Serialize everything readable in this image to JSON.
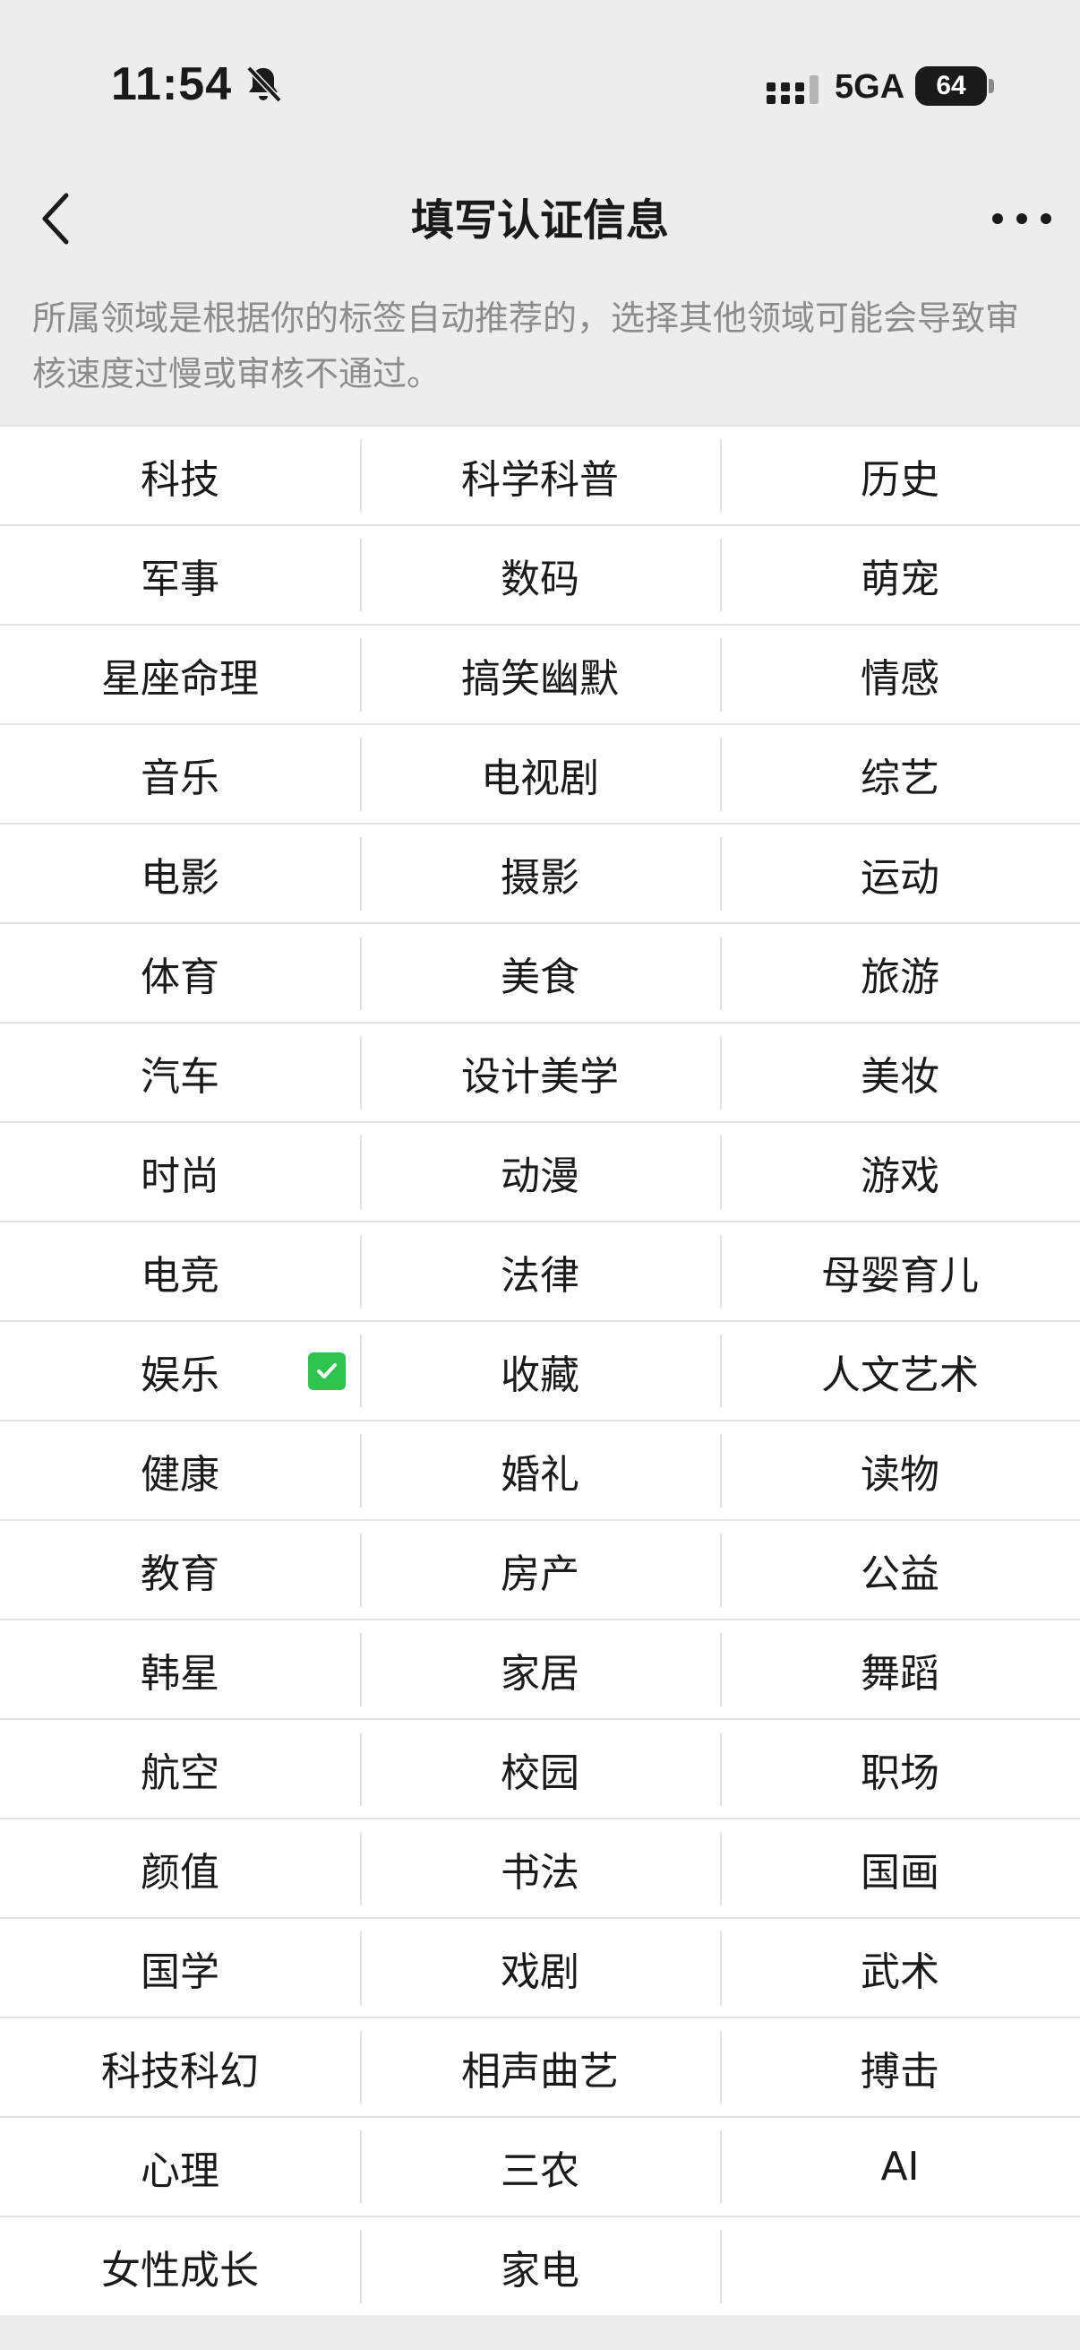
{
  "status_bar": {
    "time": "11:54",
    "network": "5GA",
    "battery": "64",
    "icons": [
      "bell-muted-icon",
      "signal-icon",
      "battery-icon"
    ]
  },
  "nav": {
    "title": "填写认证信息",
    "back_icon": "chevron-left-icon",
    "more_icon": "more-dots-icon"
  },
  "notice": "所属领域是根据你的标签自动推荐的，选择其他领域可能会导致审核速度过慢或审核不通过。",
  "accent_color": "#2dc34f",
  "categories": {
    "rows": [
      [
        "科技",
        "科学科普",
        "历史"
      ],
      [
        "军事",
        "数码",
        "萌宠"
      ],
      [
        "星座命理",
        "搞笑幽默",
        "情感"
      ],
      [
        "音乐",
        "电视剧",
        "综艺"
      ],
      [
        "电影",
        "摄影",
        "运动"
      ],
      [
        "体育",
        "美食",
        "旅游"
      ],
      [
        "汽车",
        "设计美学",
        "美妆"
      ],
      [
        "时尚",
        "动漫",
        "游戏"
      ],
      [
        "电竞",
        "法律",
        "母婴育儿"
      ],
      [
        "娱乐",
        "收藏",
        "人文艺术"
      ],
      [
        "健康",
        "婚礼",
        "读物"
      ],
      [
        "教育",
        "房产",
        "公益"
      ],
      [
        "韩星",
        "家居",
        "舞蹈"
      ],
      [
        "航空",
        "校园",
        "职场"
      ],
      [
        "颜值",
        "书法",
        "国画"
      ],
      [
        "国学",
        "戏剧",
        "武术"
      ],
      [
        "科技科幻",
        "相声曲艺",
        "搏击"
      ],
      [
        "心理",
        "三农",
        "AI"
      ],
      [
        "女性成长",
        "家电",
        ""
      ]
    ],
    "selected": "娱乐"
  }
}
